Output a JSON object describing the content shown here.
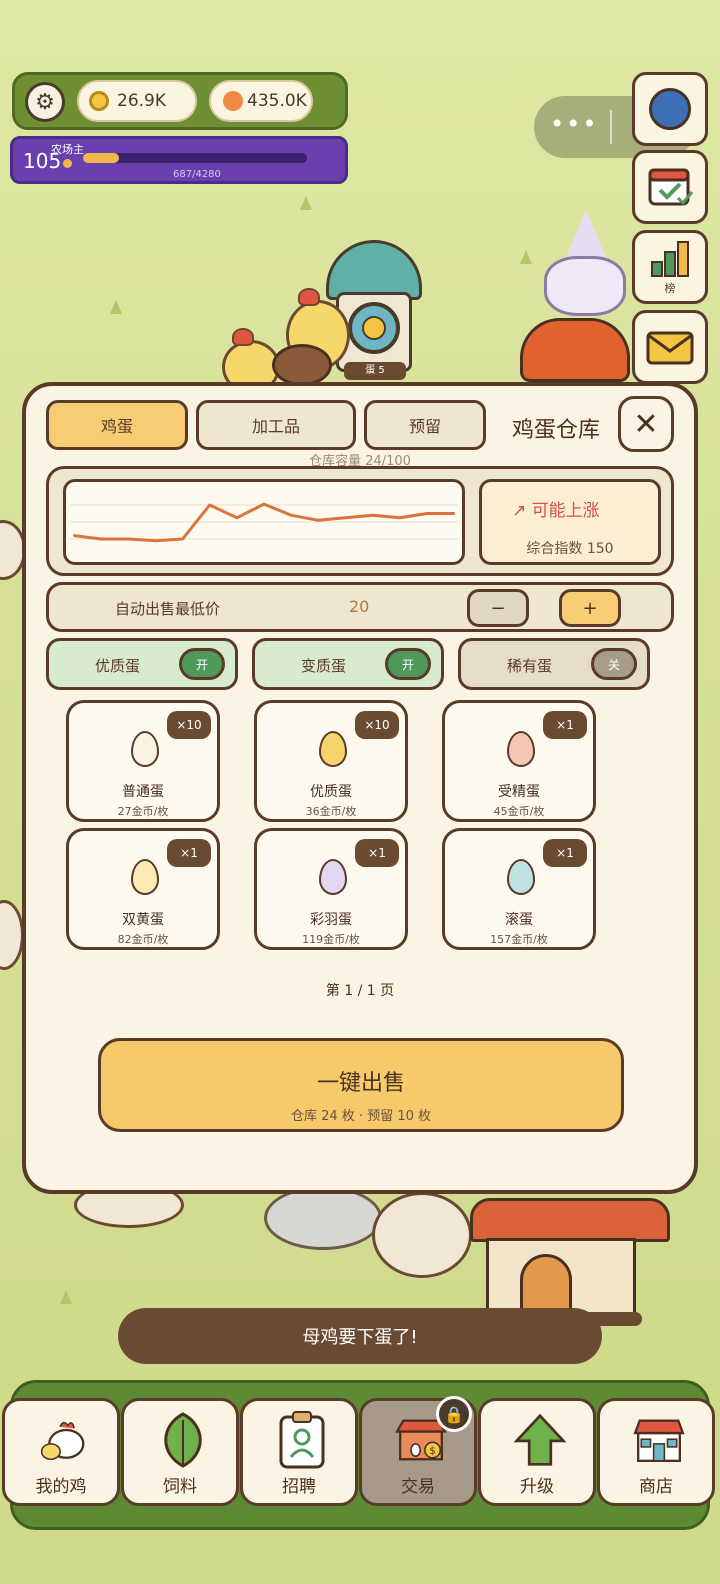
{
  "hud": {
    "gold": "26.9K",
    "orange": "435.0K",
    "level": "105",
    "level_title": "农场主",
    "xp_text": "687/4280",
    "xp_progress": 0.16
  },
  "side_buttons": {
    "rank_label": "榜"
  },
  "scene": {
    "building_label": "蛋 5"
  },
  "panel": {
    "tabs": [
      "鸡蛋",
      "加工品",
      "预留"
    ],
    "title": "鸡蛋仓库",
    "close": "✕",
    "capacity": "仓库容量 24/100",
    "trend": {
      "label": "↗ 可能上涨",
      "index_text": "综合指数 150"
    },
    "autosell": {
      "label": "自动出售最低价",
      "value": "20",
      "minus": "−",
      "plus": "+"
    },
    "toggles": [
      {
        "label": "优质蛋",
        "state": "开"
      },
      {
        "label": "变质蛋",
        "state": "开"
      },
      {
        "label": "稀有蛋",
        "state": "关"
      }
    ],
    "eggs": [
      {
        "name": "普通蛋",
        "price": "27金币/枚",
        "qty": "×10",
        "color": "#fbf3e2"
      },
      {
        "name": "优质蛋",
        "price": "36金币/枚",
        "qty": "×10",
        "color": "#f5d46a"
      },
      {
        "name": "受精蛋",
        "price": "45金币/枚",
        "qty": "×1",
        "color": "#f6c6b4"
      },
      {
        "name": "双黄蛋",
        "price": "82金币/枚",
        "qty": "×1",
        "color": "#fbeab6"
      },
      {
        "name": "彩羽蛋",
        "price": "119金币/枚",
        "qty": "×1",
        "color": "#e5d6f2"
      },
      {
        "name": "滚蛋",
        "price": "157金币/枚",
        "qty": "×1",
        "color": "#bfe3e3"
      }
    ],
    "pager": "第 1 / 1 页",
    "sell": {
      "label": "一键出售",
      "sub": "仓库 24 枚 · 预留 10 枚"
    }
  },
  "toast": "母鸡要下蛋了!",
  "nav": [
    {
      "label": "我的鸡",
      "icon": "chicken-icon"
    },
    {
      "label": "饲料",
      "icon": "leaf-icon"
    },
    {
      "label": "招聘",
      "icon": "badge-icon"
    },
    {
      "label": "交易",
      "icon": "market-icon"
    },
    {
      "label": "升级",
      "icon": "arrow-up-icon"
    },
    {
      "label": "商店",
      "icon": "shop-icon"
    }
  ],
  "chart_data": {
    "type": "line",
    "x": [
      0,
      1,
      2,
      3,
      4,
      5,
      6,
      7,
      8,
      9,
      10,
      11,
      12,
      13,
      14
    ],
    "series": [
      {
        "values": [
          64,
          60,
          60,
          58,
          60,
          100,
          85,
          101,
          88,
          82,
          85,
          88,
          85,
          90,
          90
        ]
      }
    ],
    "ylim": [
      40,
      120
    ],
    "grid": true,
    "color": "#d9743f"
  }
}
